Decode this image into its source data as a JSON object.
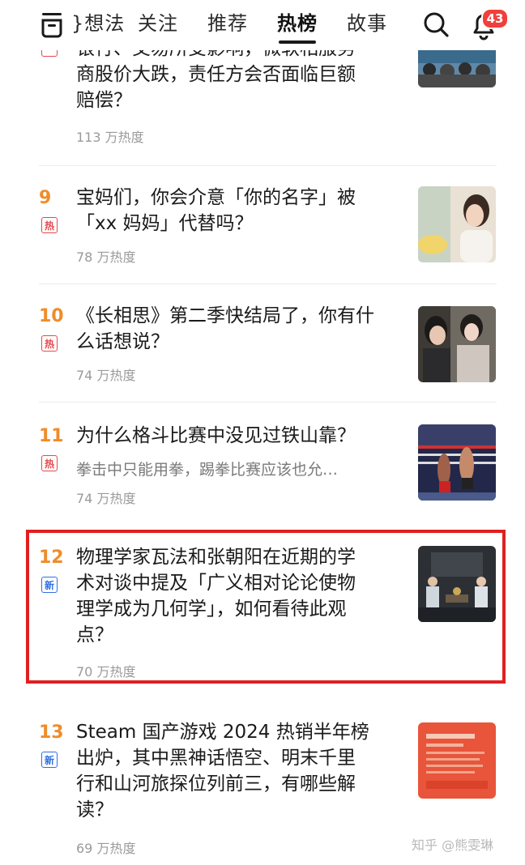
{
  "nav": {
    "tabs": [
      {
        "label": "想法",
        "visible": "}想法"
      },
      {
        "label": "关注"
      },
      {
        "label": "推荐"
      },
      {
        "label": "热榜"
      },
      {
        "label": "故事"
      }
    ],
    "active_tab": "热榜",
    "notification_count": "43"
  },
  "items": [
    {
      "rank": "",
      "title_lines": [
        "银行、交易所受影响，微软相服务",
        "商股价大跌，责任方会否面临巨额",
        "赔偿？"
      ],
      "heat": "113 万热度"
    },
    {
      "rank": "9",
      "tag": "热",
      "title_lines": [
        "宝妈们，你会介意「你的名字」被",
        "「xx 妈妈」代替吗？"
      ],
      "heat": "78 万热度"
    },
    {
      "rank": "10",
      "tag": "热",
      "title_lines": [
        "《长相思》第二季快结局了，你有什",
        "么话想说？"
      ],
      "heat": "74 万热度"
    },
    {
      "rank": "11",
      "tag": "热",
      "title_lines": [
        "为什么格斗比赛中没见过铁山靠？"
      ],
      "excerpt": "拳击中只能用拳，踢拳比赛应该也允…",
      "heat": "74 万热度"
    },
    {
      "rank": "12",
      "tag": "新",
      "title_lines": [
        "物理学家瓦法和张朝阳在近期的学",
        "术对谈中提及「广义相对论论使物",
        "理学成为几何学」，如何看待此观",
        "点？"
      ],
      "heat": "70 万热度"
    },
    {
      "rank": "13",
      "tag": "新",
      "title_lines": [
        "Steam 国产游戏 2024 热销半年榜",
        "出炉，其中黑神话悟空、明末千里",
        "行和山河旅探位列前三，有哪些解",
        "读？"
      ],
      "heat": "69 万热度"
    }
  ],
  "watermark": "知乎 @熊雯琳",
  "colors": {
    "rank": "#f08c2a",
    "hot_tag": "#e5484d",
    "new_tag": "#2f6fe4",
    "highlight_border": "#e02020",
    "badge": "#f1403c"
  }
}
